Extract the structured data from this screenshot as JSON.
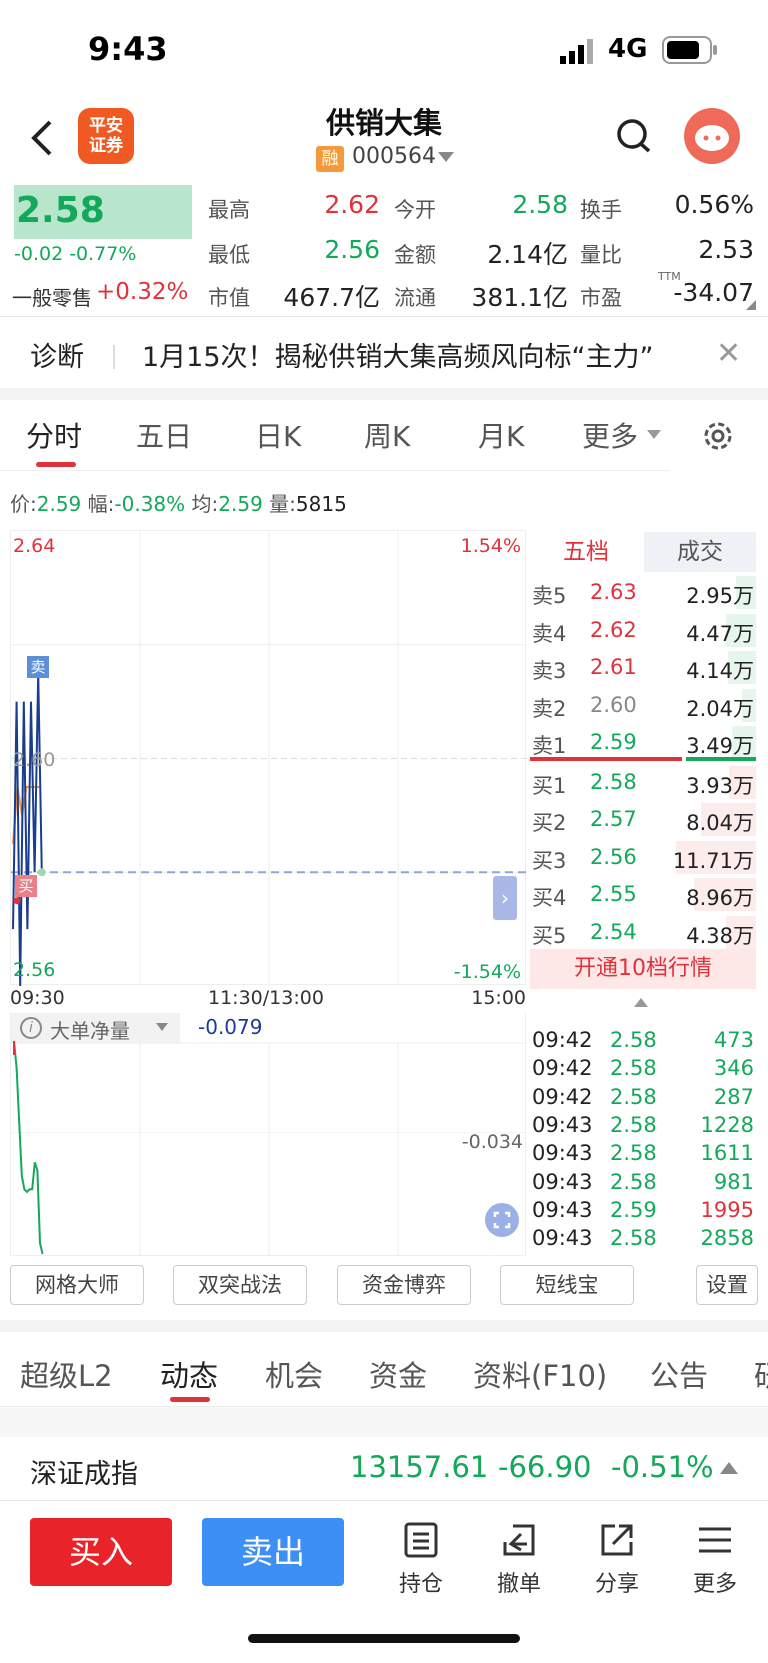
{
  "status": {
    "time": "9:43",
    "network": "4G"
  },
  "header": {
    "logo_line1": "平安",
    "logo_line2": "证券",
    "title": "供销大集",
    "badge": "融",
    "code": "000564"
  },
  "quote": {
    "price": "2.58",
    "change": "-0.02 -0.77%",
    "retail_label": "一般零售",
    "retail_change": "+0.32%",
    "stats": [
      {
        "label": "最高",
        "value": "2.62",
        "color": "red"
      },
      {
        "label": "今开",
        "value": "2.58",
        "color": "green"
      },
      {
        "label": "换手",
        "value": "0.56%",
        "color": "black"
      },
      {
        "label": "最低",
        "value": "2.56",
        "color": "green"
      },
      {
        "label": "金额",
        "value": "2.14亿",
        "color": "black"
      },
      {
        "label": "量比",
        "value": "2.53",
        "color": "black"
      },
      {
        "label": "市值",
        "value": "467.7亿",
        "color": "black"
      },
      {
        "label": "流通",
        "value": "381.1亿",
        "color": "black"
      },
      {
        "label": "市盈",
        "value": "-34.07",
        "color": "black"
      }
    ],
    "pe_tag": "TTM"
  },
  "diagnosis": {
    "label": "诊断",
    "text": "1月15次！揭秘供销大集高频风向标“主力”",
    "close": "✕"
  },
  "chart_tabs": [
    "分时",
    "五日",
    "日K",
    "周K",
    "月K",
    "更多"
  ],
  "infoline": {
    "price_label": "价:",
    "price": "2.59",
    "amp_label": "幅:",
    "amp": "-0.38%",
    "avg_label": "均:",
    "avg": "2.59",
    "vol_label": "量:",
    "vol": "5815"
  },
  "chart_data": {
    "type": "line",
    "ylim": [
      2.56,
      2.64
    ],
    "y_top_label": "2.64",
    "y_mid_label": "2.60",
    "y_bottom_label": "2.56",
    "pct_top": "1.54%",
    "pct_bottom": "-1.54%",
    "x_labels": [
      "09:30",
      "11:30/13:00",
      "15:00"
    ],
    "prev_close": 2.58,
    "series": [
      {
        "values": [
          2.57,
          2.61,
          2.56,
          2.61,
          2.57,
          2.61,
          2.58,
          2.615,
          2.58
        ]
      },
      {
        "values": [
          2.585,
          2.595,
          2.59,
          2.595,
          2.595,
          2.595,
          2.595
        ]
      }
    ],
    "markers": {
      "sell": "卖",
      "buy": "买"
    },
    "colors": {
      "price": "#1b3d8f",
      "avg": "#f39a3a",
      "prev": "#8fa6d9"
    }
  },
  "vol_chart": {
    "label": "大单净量",
    "value": "-0.079",
    "axis_value": "-0.034",
    "values": [
      0.0,
      -0.01,
      -0.03,
      -0.05,
      -0.055,
      -0.056,
      -0.055,
      -0.055,
      -0.045,
      -0.048,
      -0.075,
      -0.079
    ]
  },
  "orderbook": {
    "tab_active": "五档",
    "tab_other": "成交",
    "rows": [
      {
        "side": "卖5",
        "price": "2.63",
        "vol": "2.95万",
        "pcolor": "red",
        "bar": 0.25,
        "bar_color": "#e6f6ec"
      },
      {
        "side": "卖4",
        "price": "2.62",
        "vol": "4.47万",
        "pcolor": "red",
        "bar": 0.37,
        "bar_color": "#e6f6ec"
      },
      {
        "side": "卖3",
        "price": "2.61",
        "vol": "4.14万",
        "pcolor": "red",
        "bar": 0.35,
        "bar_color": "#e6f6ec"
      },
      {
        "side": "卖2",
        "price": "2.60",
        "vol": "2.04万",
        "pcolor": "gray",
        "bar": 0.17,
        "bar_color": "#e6f6ec"
      },
      {
        "side": "卖1",
        "price": "2.59",
        "vol": "3.49万",
        "pcolor": "green",
        "bar": 0.3,
        "bar_color": "#e6f6ec"
      },
      {
        "side": "买1",
        "price": "2.58",
        "vol": "3.93万",
        "pcolor": "green",
        "bar": 0.34,
        "bar_color": "#fdecec"
      },
      {
        "side": "买2",
        "price": "2.57",
        "vol": "8.04万",
        "pcolor": "green",
        "bar": 0.69,
        "bar_color": "#fdecec"
      },
      {
        "side": "买3",
        "price": "2.56",
        "vol": "11.71万",
        "pcolor": "green",
        "bar": 1.0,
        "bar_color": "#fdecec"
      },
      {
        "side": "买4",
        "price": "2.55",
        "vol": "8.96万",
        "pcolor": "green",
        "bar": 0.77,
        "bar_color": "#fdecec"
      },
      {
        "side": "买5",
        "price": "2.54",
        "vol": "4.38万",
        "pcolor": "green",
        "bar": 0.38,
        "bar_color": "#fdecec"
      }
    ],
    "open10": "开通10档行情"
  },
  "trades": [
    {
      "time": "09:42",
      "price": "2.58",
      "vol": "473",
      "vcolor": "green"
    },
    {
      "time": "09:42",
      "price": "2.58",
      "vol": "346",
      "vcolor": "green"
    },
    {
      "time": "09:42",
      "price": "2.58",
      "vol": "287",
      "vcolor": "green"
    },
    {
      "time": "09:43",
      "price": "2.58",
      "vol": "1228",
      "vcolor": "green"
    },
    {
      "time": "09:43",
      "price": "2.58",
      "vol": "1611",
      "vcolor": "green"
    },
    {
      "time": "09:43",
      "price": "2.58",
      "vol": "981",
      "vcolor": "green"
    },
    {
      "time": "09:43",
      "price": "2.59",
      "vol": "1995",
      "vcolor": "red"
    },
    {
      "time": "09:43",
      "price": "2.58",
      "vol": "2858",
      "vcolor": "green"
    }
  ],
  "strategies": [
    "网格大师",
    "双突战法",
    "资金博弈",
    "短线宝",
    "设置"
  ],
  "bottom_tabs": [
    "超级L2",
    "动态",
    "机会",
    "资金",
    "资料(F10)",
    "公告",
    "研"
  ],
  "index": {
    "name": "深证成指",
    "value": "13157.61",
    "change": "-66.90",
    "pct": "-0.51%"
  },
  "actions": {
    "buy": "买入",
    "sell": "卖出",
    "holdings": "持仓",
    "cancel": "撤单",
    "share": "分享",
    "more": "更多"
  }
}
